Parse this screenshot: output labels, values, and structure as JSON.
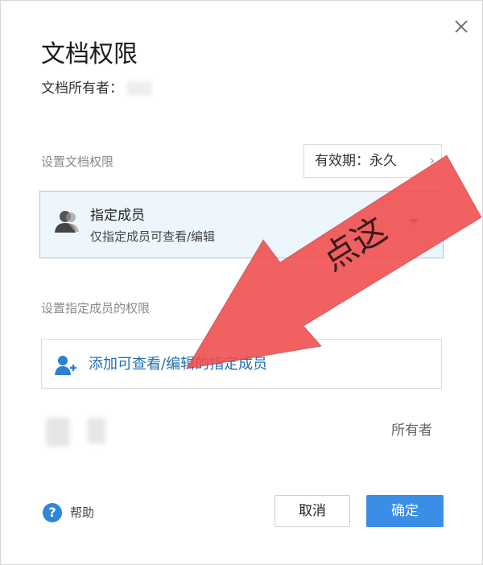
{
  "dialog": {
    "title": "文档权限",
    "owner_label": "文档所有者："
  },
  "doc_permission": {
    "section_label": "设置文档权限",
    "validity_label": "有效期：永久",
    "selected_option": {
      "title": "指定成员",
      "description": "仅指定成员可查看/编辑"
    }
  },
  "member_permission": {
    "section_label": "设置指定成员的权限",
    "add_member_label": "添加可查看/编辑的指定成员",
    "members": [
      {
        "role": "所有者"
      }
    ]
  },
  "footer": {
    "help_label": "帮助",
    "cancel_label": "取消",
    "confirm_label": "确定"
  },
  "annotation": {
    "text": "点这"
  },
  "colors": {
    "accent": "#3a8ee6",
    "link": "#1f6fb5",
    "selected_bg": "#eef6fd",
    "arrow": "#f04b4b"
  },
  "icons": {
    "close": "close-icon",
    "user": "user-icon",
    "add_user": "add-user-icon",
    "help": "help-icon",
    "chevron": "chevron-right-icon",
    "dropdown": "caret-down-icon"
  }
}
